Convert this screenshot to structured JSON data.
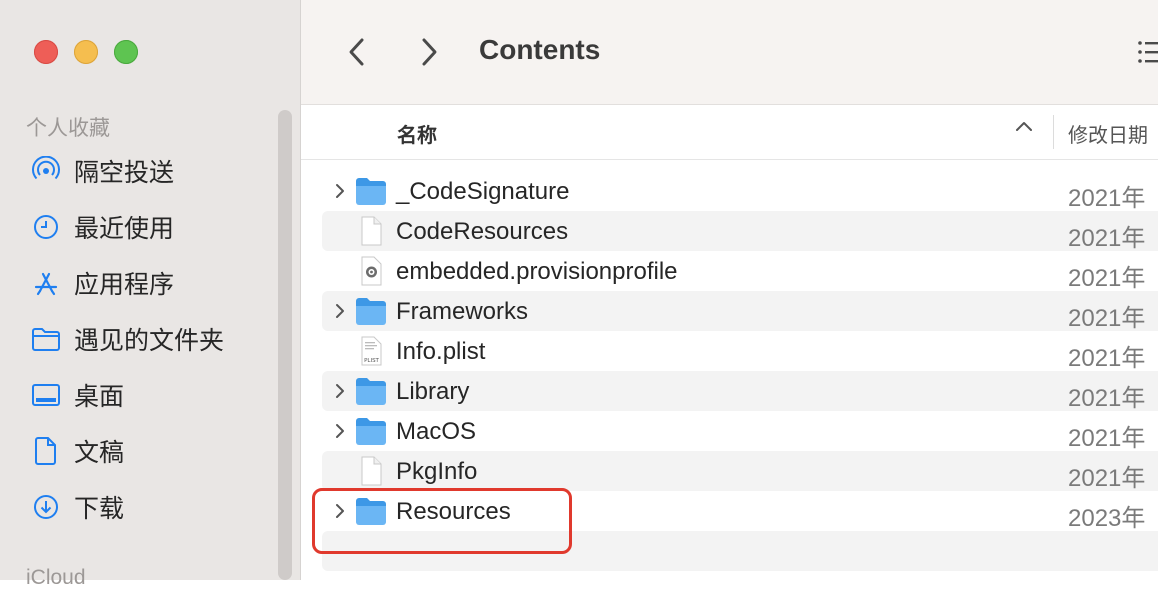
{
  "window": {
    "title": "Contents"
  },
  "sidebar": {
    "favorites_title": "个人收藏",
    "items": [
      {
        "label": "隔空投送",
        "icon": "airdrop-icon"
      },
      {
        "label": "最近使用",
        "icon": "clock-icon"
      },
      {
        "label": "应用程序",
        "icon": "applications-icon"
      },
      {
        "label": "遇见的文件夹",
        "icon": "folder-icon"
      },
      {
        "label": "桌面",
        "icon": "desktop-icon"
      },
      {
        "label": "文稿",
        "icon": "document-icon"
      },
      {
        "label": "下载",
        "icon": "download-icon"
      }
    ],
    "icloud_title": "iCloud"
  },
  "columns": {
    "name": "名称",
    "date": "修改日期"
  },
  "files": [
    {
      "name": "_CodeSignature",
      "kind": "folder",
      "date": "2021年"
    },
    {
      "name": "CodeResources",
      "kind": "file",
      "date": "2021年"
    },
    {
      "name": "embedded.provisionprofile",
      "kind": "profile",
      "date": "2021年"
    },
    {
      "name": "Frameworks",
      "kind": "folder",
      "date": "2021年"
    },
    {
      "name": "Info.plist",
      "kind": "plist",
      "date": "2021年"
    },
    {
      "name": "Library",
      "kind": "folder",
      "date": "2021年"
    },
    {
      "name": "MacOS",
      "kind": "folder",
      "date": "2021年"
    },
    {
      "name": "PkgInfo",
      "kind": "file",
      "date": "2021年"
    },
    {
      "name": "Resources",
      "kind": "folder",
      "date": "2023年"
    }
  ],
  "plist_icon_text": "PLIST",
  "colors": {
    "accent": "#1f7ff0",
    "highlight": "#e0392d",
    "folder": "#5aacef"
  }
}
